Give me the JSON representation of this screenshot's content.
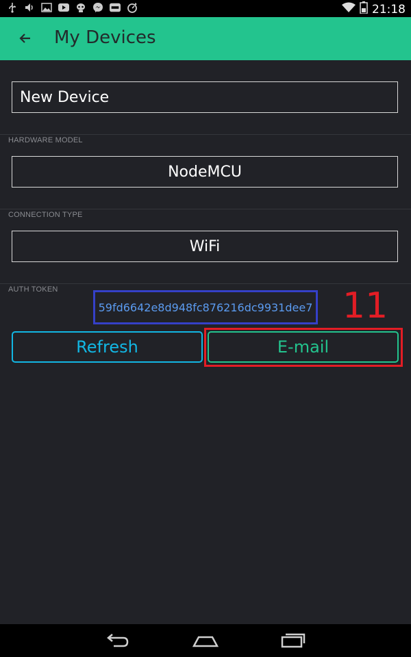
{
  "status_bar": {
    "time": "21:18",
    "left_icons": [
      "usb-icon",
      "volume-icon",
      "image-icon",
      "youtube-icon",
      "alien-icon",
      "messenger-icon",
      "sale-icon",
      "sync-icon"
    ],
    "right_icons": [
      "wifi-icon",
      "battery-icon"
    ]
  },
  "app_bar": {
    "title": "My Devices",
    "back_icon": "arrow-left-icon",
    "color": "#23c48e"
  },
  "device": {
    "name": "New Device",
    "hardware_model_label": "HARDWARE MODEL",
    "hardware_model": "NodeMCU",
    "connection_type_label": "CONNECTION TYPE",
    "connection_type": "WiFi",
    "auth_token_label": "AUTH TOKEN",
    "auth_token": "59fd6642e8d948fc876216dc9931dee7"
  },
  "annotation": {
    "step_number": "11",
    "color": "#e21d25"
  },
  "buttons": {
    "refresh": "Refresh",
    "email": "E-mail"
  },
  "colors": {
    "background": "#212227",
    "refresh": "#12b7e4",
    "email": "#23c48e",
    "token_highlight": "#3540c8"
  },
  "nav_bar": {
    "icons": [
      "back-icon",
      "home-icon",
      "recents-icon"
    ]
  }
}
